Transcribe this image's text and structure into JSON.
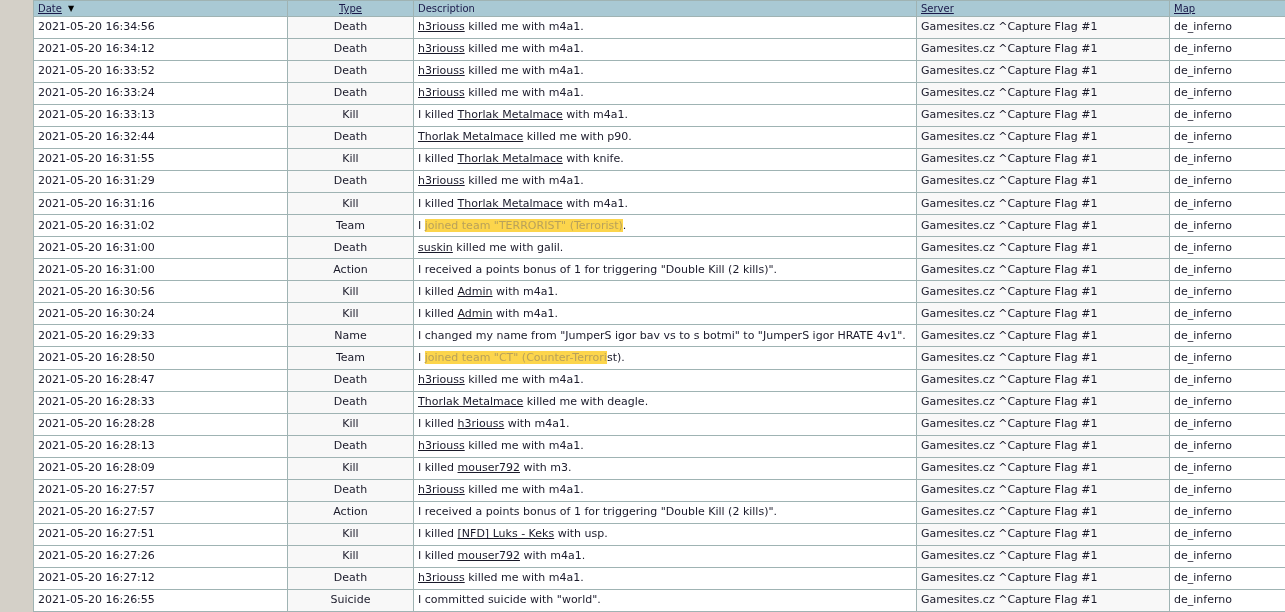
{
  "table": {
    "columns": [
      {
        "label": "Date",
        "kind": "link",
        "sort_indicator": "▼"
      },
      {
        "label": "Type",
        "kind": "link"
      },
      {
        "label": "Description",
        "kind": "plain"
      },
      {
        "label": "Server",
        "kind": "link"
      },
      {
        "label": "Map",
        "kind": "link"
      }
    ],
    "rows": [
      {
        "date": "2021-05-20 16:34:56",
        "type": "Death",
        "description": [
          {
            "kind": "link",
            "text": "h3riouss"
          },
          {
            "kind": "text",
            "text": " killed me with m4a1."
          }
        ],
        "server": "Gamesites.cz ^Capture Flag #1",
        "map": "de_inferno"
      },
      {
        "date": "2021-05-20 16:34:12",
        "type": "Death",
        "description": [
          {
            "kind": "link",
            "text": "h3riouss"
          },
          {
            "kind": "text",
            "text": " killed me with m4a1."
          }
        ],
        "server": "Gamesites.cz ^Capture Flag #1",
        "map": "de_inferno"
      },
      {
        "date": "2021-05-20 16:33:52",
        "type": "Death",
        "description": [
          {
            "kind": "link",
            "text": "h3riouss"
          },
          {
            "kind": "text",
            "text": " killed me with m4a1."
          }
        ],
        "server": "Gamesites.cz ^Capture Flag #1",
        "map": "de_inferno"
      },
      {
        "date": "2021-05-20 16:33:24",
        "type": "Death",
        "description": [
          {
            "kind": "link",
            "text": "h3riouss"
          },
          {
            "kind": "text",
            "text": " killed me with m4a1."
          }
        ],
        "server": "Gamesites.cz ^Capture Flag #1",
        "map": "de_inferno"
      },
      {
        "date": "2021-05-20 16:33:13",
        "type": "Kill",
        "description": [
          {
            "kind": "text",
            "text": "I killed "
          },
          {
            "kind": "link",
            "text": "Thorlak Metalmace"
          },
          {
            "kind": "text",
            "text": " with m4a1."
          }
        ],
        "server": "Gamesites.cz ^Capture Flag #1",
        "map": "de_inferno"
      },
      {
        "date": "2021-05-20 16:32:44",
        "type": "Death",
        "description": [
          {
            "kind": "link",
            "text": "Thorlak Metalmace"
          },
          {
            "kind": "text",
            "text": " killed me with p90."
          }
        ],
        "server": "Gamesites.cz ^Capture Flag #1",
        "map": "de_inferno"
      },
      {
        "date": "2021-05-20 16:31:55",
        "type": "Kill",
        "description": [
          {
            "kind": "text",
            "text": "I killed "
          },
          {
            "kind": "link",
            "text": "Thorlak Metalmace"
          },
          {
            "kind": "text",
            "text": " with knife."
          }
        ],
        "server": "Gamesites.cz ^Capture Flag #1",
        "map": "de_inferno"
      },
      {
        "date": "2021-05-20 16:31:29",
        "type": "Death",
        "description": [
          {
            "kind": "link",
            "text": "h3riouss"
          },
          {
            "kind": "text",
            "text": " killed me with m4a1."
          }
        ],
        "server": "Gamesites.cz ^Capture Flag #1",
        "map": "de_inferno"
      },
      {
        "date": "2021-05-20 16:31:16",
        "type": "Kill",
        "description": [
          {
            "kind": "text",
            "text": "I killed "
          },
          {
            "kind": "link",
            "text": "Thorlak Metalmace"
          },
          {
            "kind": "text",
            "text": " with m4a1."
          }
        ],
        "server": "Gamesites.cz ^Capture Flag #1",
        "map": "de_inferno"
      },
      {
        "date": "2021-05-20 16:31:02",
        "type": "Team",
        "description": [
          {
            "kind": "text",
            "text": "I "
          },
          {
            "kind": "highlight",
            "text": "joined team \"TERRORIST\" (Terrorist)"
          },
          {
            "kind": "text",
            "text": "."
          }
        ],
        "server": "Gamesites.cz ^Capture Flag #1",
        "map": "de_inferno"
      },
      {
        "date": "2021-05-20 16:31:00",
        "type": "Death",
        "description": [
          {
            "kind": "link",
            "text": "suskin"
          },
          {
            "kind": "text",
            "text": " killed me with galil."
          }
        ],
        "server": "Gamesites.cz ^Capture Flag #1",
        "map": "de_inferno"
      },
      {
        "date": "2021-05-20 16:31:00",
        "type": "Action",
        "description": [
          {
            "kind": "text",
            "text": "I received a points bonus of 1 for triggering \"Double Kill (2 kills)\"."
          }
        ],
        "server": "Gamesites.cz ^Capture Flag #1",
        "map": "de_inferno"
      },
      {
        "date": "2021-05-20 16:30:56",
        "type": "Kill",
        "description": [
          {
            "kind": "text",
            "text": "I killed "
          },
          {
            "kind": "link",
            "text": "Admin"
          },
          {
            "kind": "text",
            "text": " with m4a1."
          }
        ],
        "server": "Gamesites.cz ^Capture Flag #1",
        "map": "de_inferno"
      },
      {
        "date": "2021-05-20 16:30:24",
        "type": "Kill",
        "description": [
          {
            "kind": "text",
            "text": "I killed "
          },
          {
            "kind": "link",
            "text": "Admin"
          },
          {
            "kind": "text",
            "text": " with m4a1."
          }
        ],
        "server": "Gamesites.cz ^Capture Flag #1",
        "map": "de_inferno"
      },
      {
        "date": "2021-05-20 16:29:33",
        "type": "Name",
        "description": [
          {
            "kind": "text",
            "text": "I changed my name from \"JumperS igor bav vs to s botmi\" to \"JumperS igor HRATE 4v1\"."
          }
        ],
        "server": "Gamesites.cz ^Capture Flag #1",
        "map": "de_inferno"
      },
      {
        "date": "2021-05-20 16:28:50",
        "type": "Team",
        "description": [
          {
            "kind": "text",
            "text": "I "
          },
          {
            "kind": "highlight",
            "text": "joined team \"CT\" (Counter-Terrori"
          },
          {
            "kind": "text",
            "text": "st)."
          }
        ],
        "server": "Gamesites.cz ^Capture Flag #1",
        "map": "de_inferno"
      },
      {
        "date": "2021-05-20 16:28:47",
        "type": "Death",
        "description": [
          {
            "kind": "link",
            "text": "h3riouss"
          },
          {
            "kind": "text",
            "text": " killed me with m4a1."
          }
        ],
        "server": "Gamesites.cz ^Capture Flag #1",
        "map": "de_inferno"
      },
      {
        "date": "2021-05-20 16:28:33",
        "type": "Death",
        "description": [
          {
            "kind": "link",
            "text": "Thorlak Metalmace"
          },
          {
            "kind": "text",
            "text": " killed me with deagle."
          }
        ],
        "server": "Gamesites.cz ^Capture Flag #1",
        "map": "de_inferno"
      },
      {
        "date": "2021-05-20 16:28:28",
        "type": "Kill",
        "description": [
          {
            "kind": "text",
            "text": "I killed "
          },
          {
            "kind": "link",
            "text": "h3riouss"
          },
          {
            "kind": "text",
            "text": " with m4a1."
          }
        ],
        "server": "Gamesites.cz ^Capture Flag #1",
        "map": "de_inferno"
      },
      {
        "date": "2021-05-20 16:28:13",
        "type": "Death",
        "description": [
          {
            "kind": "link",
            "text": "h3riouss"
          },
          {
            "kind": "text",
            "text": " killed me with m4a1."
          }
        ],
        "server": "Gamesites.cz ^Capture Flag #1",
        "map": "de_inferno"
      },
      {
        "date": "2021-05-20 16:28:09",
        "type": "Kill",
        "description": [
          {
            "kind": "text",
            "text": "I killed "
          },
          {
            "kind": "link",
            "text": "mouser792"
          },
          {
            "kind": "text",
            "text": " with m3."
          }
        ],
        "server": "Gamesites.cz ^Capture Flag #1",
        "map": "de_inferno"
      },
      {
        "date": "2021-05-20 16:27:57",
        "type": "Death",
        "description": [
          {
            "kind": "link",
            "text": "h3riouss"
          },
          {
            "kind": "text",
            "text": " killed me with m4a1."
          }
        ],
        "server": "Gamesites.cz ^Capture Flag #1",
        "map": "de_inferno"
      },
      {
        "date": "2021-05-20 16:27:57",
        "type": "Action",
        "description": [
          {
            "kind": "text",
            "text": "I received a points bonus of 1 for triggering \"Double Kill (2 kills)\"."
          }
        ],
        "server": "Gamesites.cz ^Capture Flag #1",
        "map": "de_inferno"
      },
      {
        "date": "2021-05-20 16:27:51",
        "type": "Kill",
        "description": [
          {
            "kind": "text",
            "text": "I killed "
          },
          {
            "kind": "link",
            "text": "[NFD] Luks - Keks"
          },
          {
            "kind": "text",
            "text": " with usp."
          }
        ],
        "server": "Gamesites.cz ^Capture Flag #1",
        "map": "de_inferno"
      },
      {
        "date": "2021-05-20 16:27:26",
        "type": "Kill",
        "description": [
          {
            "kind": "text",
            "text": "I killed "
          },
          {
            "kind": "link",
            "text": "mouser792"
          },
          {
            "kind": "text",
            "text": " with m4a1."
          }
        ],
        "server": "Gamesites.cz ^Capture Flag #1",
        "map": "de_inferno"
      },
      {
        "date": "2021-05-20 16:27:12",
        "type": "Death",
        "description": [
          {
            "kind": "link",
            "text": "h3riouss"
          },
          {
            "kind": "text",
            "text": " killed me with m4a1."
          }
        ],
        "server": "Gamesites.cz ^Capture Flag #1",
        "map": "de_inferno"
      },
      {
        "date": "2021-05-20 16:26:55",
        "type": "Suicide",
        "description": [
          {
            "kind": "text",
            "text": "I committed suicide with \"world\"."
          }
        ],
        "server": "Gamesites.cz ^Capture Flag #1",
        "map": "de_inferno"
      }
    ]
  }
}
